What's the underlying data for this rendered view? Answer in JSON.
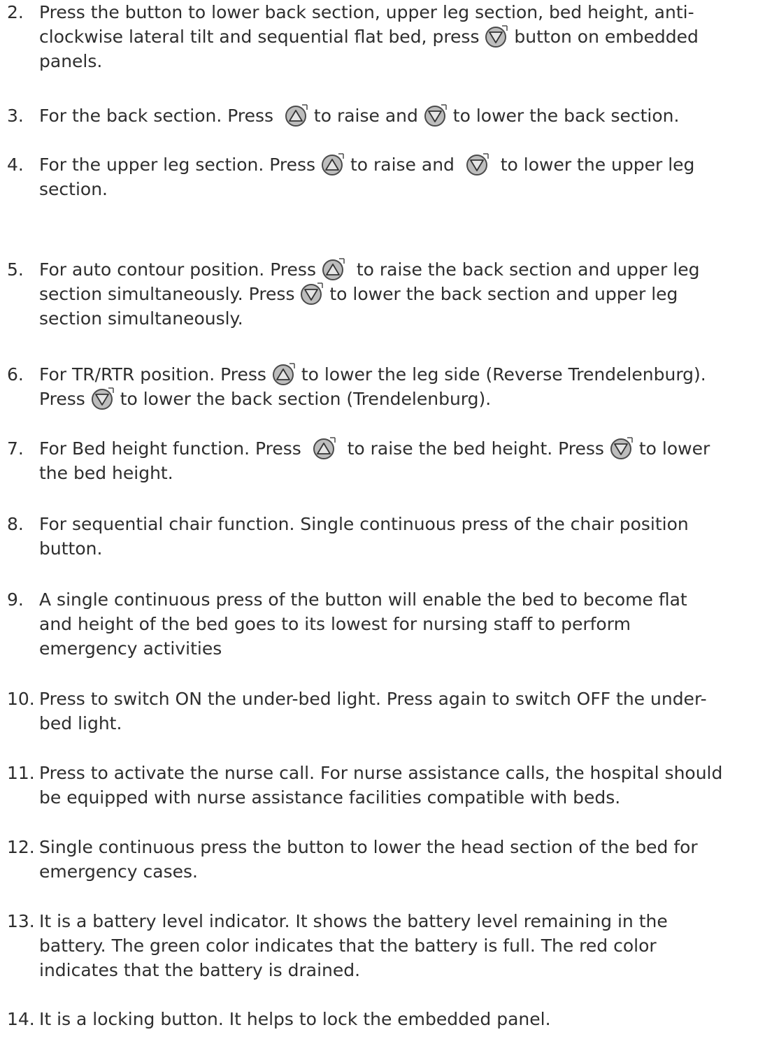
{
  "items": [
    {
      "number": "2.",
      "lines": [
        [
          "Press the button to lower back section, upper leg section, bed height, anti-"
        ],
        [
          "clockwise lateral tilt and sequential flat bed, press ",
          {
            "icon": "down-arrow-button-icon"
          },
          " button on embedded"
        ],
        [
          "panels."
        ]
      ]
    },
    {
      "number": "3.",
      "lines": [
        [
          "For the back section. Press  ",
          {
            "icon": "up-arrow-button-icon"
          },
          " to raise and ",
          {
            "icon": "down-arrow-button-icon"
          },
          " to lower the back section."
        ]
      ]
    },
    {
      "number": "4.",
      "lines": [
        [
          "For the upper leg section. Press ",
          {
            "icon": "up-arrow-button-icon"
          },
          " to raise and  ",
          {
            "icon": "down-arrow-button-icon"
          },
          "  to lower the upper leg"
        ],
        [
          "section."
        ]
      ]
    },
    {
      "number": "5.",
      "lines": [
        [
          "For auto contour position. Press ",
          {
            "icon": "up-arrow-button-icon"
          },
          "  to raise the back section and upper leg"
        ],
        [
          "section simultaneously. Press ",
          {
            "icon": "down-arrow-button-icon"
          },
          " to lower the back section and upper leg"
        ],
        [
          "section simultaneously."
        ]
      ]
    },
    {
      "number": "6.",
      "lines": [
        [
          "For TR/RTR position. Press ",
          {
            "icon": "up-arrow-button-icon"
          },
          " to lower the leg side (Reverse Trendelenburg)."
        ],
        [
          "Press ",
          {
            "icon": "down-arrow-button-icon"
          },
          " to lower the back section (Trendelenburg)."
        ]
      ]
    },
    {
      "number": "7.",
      "lines": [
        [
          "For Bed height function. Press  ",
          {
            "icon": "up-arrow-button-icon"
          },
          "  to raise the bed height. Press ",
          {
            "icon": "down-arrow-button-icon"
          },
          " to lower"
        ],
        [
          "the bed height."
        ]
      ]
    },
    {
      "number": "8.",
      "lines": [
        [
          "For sequential chair function. Single continuous press of the chair position"
        ],
        [
          "button."
        ]
      ]
    },
    {
      "number": "9.",
      "lines": [
        [
          "A single continuous press of the button will enable the bed to become flat"
        ],
        [
          "and height of the bed goes to its lowest for nursing staff to perform"
        ],
        [
          "emergency activities"
        ]
      ]
    },
    {
      "number": "10.",
      "lines": [
        [
          "Press to switch ON the under-bed light. Press again to switch OFF the under-"
        ],
        [
          "bed light."
        ]
      ]
    },
    {
      "number": "11.",
      "lines": [
        [
          "Press to activate the nurse call. For nurse assistance calls, the hospital should"
        ],
        [
          "be equipped with nurse assistance facilities compatible with beds."
        ]
      ]
    },
    {
      "number": "12.",
      "lines": [
        [
          "Single continuous press the button to lower the head section of the bed for"
        ],
        [
          "emergency cases."
        ]
      ]
    },
    {
      "number": "13.",
      "lines": [
        [
          "It is a battery level indicator. It shows the battery level remaining in the"
        ],
        [
          "battery. The green color indicates that the battery is full. The red color"
        ],
        [
          "indicates that the battery is drained."
        ]
      ]
    },
    {
      "number": "14.",
      "lines": [
        [
          "It is a locking button. It helps to lock the embedded panel."
        ]
      ]
    }
  ]
}
